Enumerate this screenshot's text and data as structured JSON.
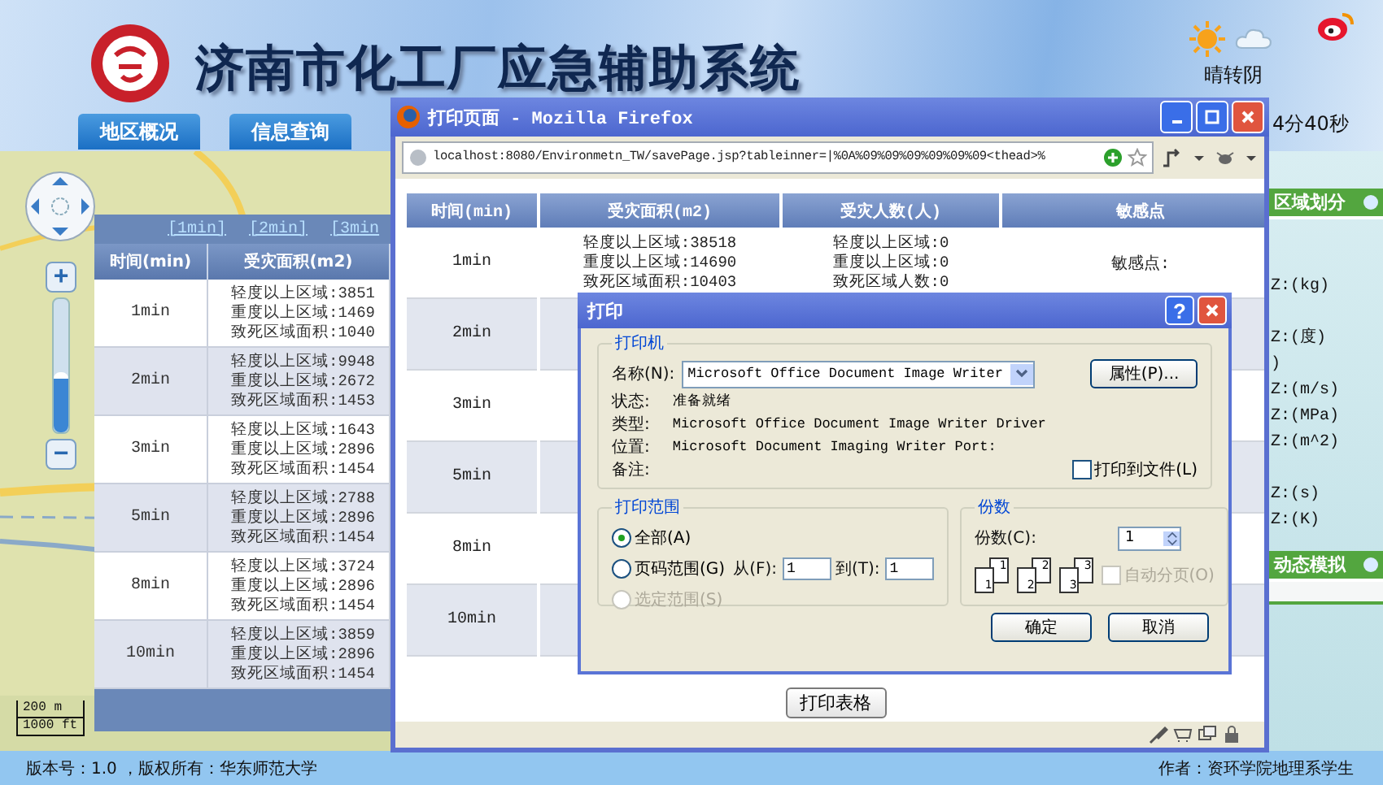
{
  "header": {
    "title": "济南市化工厂应急辅助系统",
    "weather": "晴转阴",
    "clock": "4分40秒"
  },
  "nav_tabs": [
    "地区概况",
    "信息查询"
  ],
  "map": {
    "zoom": {
      "plus": "+",
      "minus": "−",
      "level": 0.45
    },
    "scale": [
      "200 m",
      "1000 ft"
    ]
  },
  "result_panel": {
    "time_links": [
      "[1min]",
      "[2min]",
      "[3min"
    ],
    "columns": [
      "时间(min)",
      "受灾面积(m2)"
    ],
    "rows": [
      {
        "time": "1min",
        "area": [
          "轻度以上区域:3851",
          "重度以上区域:1469",
          "致死区域面积:1040"
        ]
      },
      {
        "time": "2min",
        "area": [
          "轻度以上区域:9948",
          "重度以上区域:2672",
          "致死区域面积:1453"
        ]
      },
      {
        "time": "3min",
        "area": [
          "轻度以上区域:1643",
          "重度以上区域:2896",
          "致死区域面积:1454"
        ]
      },
      {
        "time": "5min",
        "area": [
          "轻度以上区域:2788",
          "重度以上区域:2896",
          "致死区域面积:1454"
        ]
      },
      {
        "time": "8min",
        "area": [
          "轻度以上区域:3724",
          "重度以上区域:2896",
          "致死区域面积:1454"
        ]
      },
      {
        "time": "10min",
        "area": [
          "轻度以上区域:3859",
          "重度以上区域:2896",
          "致死区域面积:1454"
        ]
      }
    ]
  },
  "sidebar": {
    "sections": [
      "区域划分",
      "动态模拟"
    ],
    "param_groups": [
      [
        "Z:(kg)"
      ],
      [
        "Z:(度)",
        ")",
        "Z:(m/s)",
        "Z:(MPa)",
        "Z:(m^2)"
      ],
      [
        "Z:(s)",
        "Z:(K)"
      ]
    ]
  },
  "browser": {
    "title": "打印页面 - Mozilla Firefox",
    "url": "localhost:8080/Environmetn_TW/savePage.jsp?tableinner=|%0A%09%09%09%09%09%09<thead>%",
    "table": {
      "columns": [
        "时间(min)",
        "受灾面积(m2)",
        "受灾人数(人)",
        "敏感点"
      ],
      "rows": [
        {
          "time": "1min",
          "area": [
            "轻度以上区域:38518",
            "重度以上区域:14690",
            "致死区域面积:10403"
          ],
          "people": [
            "轻度以上区域:0",
            "重度以上区域:0",
            "致死区域人数:0"
          ],
          "sensitive": "敏感点:"
        },
        {
          "time": "2min"
        },
        {
          "time": "3min"
        },
        {
          "time": "5min"
        },
        {
          "time": "8min"
        },
        {
          "time": "10min"
        }
      ]
    },
    "print_button": "打印表格"
  },
  "print_dialog": {
    "title": "打印",
    "help": "?",
    "printer_group": "打印机",
    "name_label": "名称(N):",
    "printer": "Microsoft Office Document Image Writer",
    "properties": "属性(P)...",
    "info": [
      {
        "label": "状态:",
        "value": "准备就绪"
      },
      {
        "label": "类型:",
        "value": "Microsoft Office Document Image Writer Driver"
      },
      {
        "label": "位置:",
        "value": "Microsoft Document Imaging Writer Port:"
      },
      {
        "label": "备注:"
      }
    ],
    "print_to_file": {
      "label": "打印到文件(L)",
      "checked": false
    },
    "range_group": "打印范围",
    "range_options": [
      {
        "label": "全部(A)",
        "selected": true,
        "disabled": false
      },
      {
        "label": "页码范围(G)",
        "selected": false,
        "disabled": false
      },
      {
        "label": "选定范围(S)",
        "selected": false,
        "disabled": true
      }
    ],
    "from_label": "从(F):",
    "from": "1",
    "to_label": "到(T):",
    "to": "1",
    "copies_group": "份数",
    "copies_label": "份数(C):",
    "copies": "1",
    "collate_pages": [
      {
        "back": "1",
        "front": "1"
      },
      {
        "back": "2",
        "front": "2"
      },
      {
        "back": "3",
        "front": "3"
      }
    ],
    "collate": {
      "label": "自动分页(O)",
      "checked": false,
      "disabled": true
    },
    "buttons": [
      "确定",
      "取消"
    ]
  },
  "footer": {
    "left": "版本号：1.0 ，版权所有：华东师范大学",
    "right": "作者：资环学院地理系学生"
  }
}
